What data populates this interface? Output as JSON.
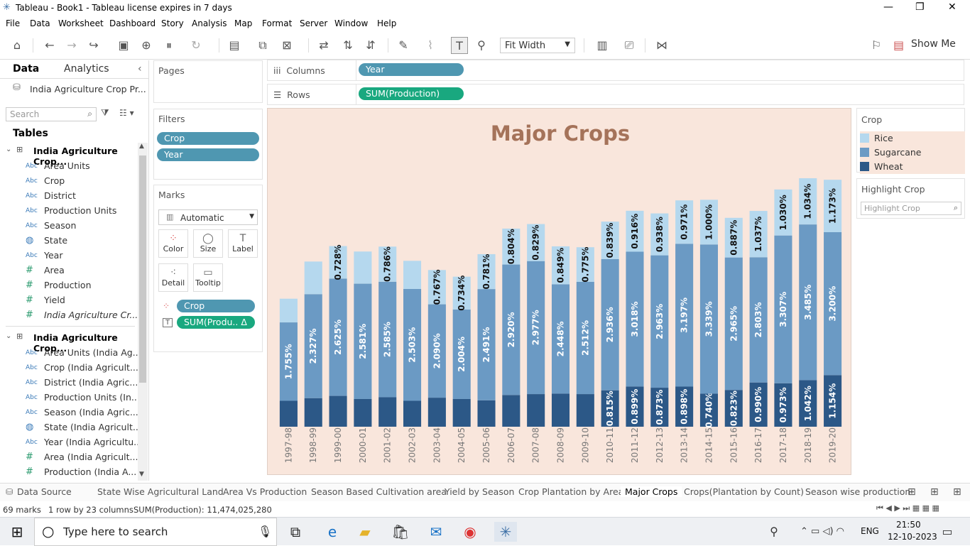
{
  "window": {
    "title": "Tableau - Book1 - Tableau license expires in 7 days"
  },
  "menu": [
    "File",
    "Data",
    "Worksheet",
    "Dashboard",
    "Story",
    "Analysis",
    "Map",
    "Format",
    "Server",
    "Window",
    "Help"
  ],
  "toolbar": {
    "fit": "Fit Width",
    "show_me": "Show Me"
  },
  "left_pane": {
    "tabs": [
      "Data",
      "Analytics"
    ],
    "datasource": "India Agriculture Crop Pr...",
    "search_placeholder": "Search",
    "tables_label": "Tables",
    "table1": {
      "name": "India Agriculture Crop...",
      "fields": [
        {
          "type": "Abc",
          "name": "Area Units"
        },
        {
          "type": "Abc",
          "name": "Crop"
        },
        {
          "type": "Abc",
          "name": "District"
        },
        {
          "type": "Abc",
          "name": "Production Units"
        },
        {
          "type": "Abc",
          "name": "Season"
        },
        {
          "type": "geo",
          "name": "State"
        },
        {
          "type": "Abc",
          "name": "Year"
        },
        {
          "type": "#",
          "name": "Area"
        },
        {
          "type": "#",
          "name": "Production"
        },
        {
          "type": "#",
          "name": "Yield"
        },
        {
          "type": "#",
          "name": "India Agriculture Cr..."
        }
      ]
    },
    "table2": {
      "name": "India Agriculture Crop...",
      "fields": [
        {
          "type": "Abc",
          "name": "Area Units (India Ag..."
        },
        {
          "type": "Abc",
          "name": "Crop (India Agricult..."
        },
        {
          "type": "Abc",
          "name": "District (India Agric..."
        },
        {
          "type": "Abc",
          "name": "Production Units (In..."
        },
        {
          "type": "Abc",
          "name": "Season (India Agric..."
        },
        {
          "type": "geo",
          "name": "State (India Agricult..."
        },
        {
          "type": "Abc",
          "name": "Year (India Agricultu..."
        },
        {
          "type": "#",
          "name": "Area (India Agricult..."
        },
        {
          "type": "#",
          "name": "Production (India A..."
        }
      ]
    }
  },
  "pages": {
    "title": "Pages"
  },
  "filters": {
    "title": "Filters",
    "items": [
      "Crop",
      "Year"
    ]
  },
  "marks": {
    "title": "Marks",
    "type": "Automatic",
    "buttons": [
      "Color",
      "Size",
      "Label",
      "Detail",
      "Tooltip"
    ],
    "pills": [
      "Crop",
      "SUM(Produ.. Δ"
    ]
  },
  "shelves": {
    "columns_label": "Columns",
    "columns_pill": "Year",
    "rows_label": "Rows",
    "rows_pill": "SUM(Production)"
  },
  "legend": {
    "title": "Crop",
    "items": [
      {
        "name": "Rice",
        "color": "#b5d8ee"
      },
      {
        "name": "Sugarcane",
        "color": "#6b9ac4"
      },
      {
        "name": "Wheat",
        "color": "#2c5887"
      }
    ]
  },
  "highlight": {
    "title": "Highlight Crop",
    "placeholder": "Highlight Crop"
  },
  "chart_data": {
    "type": "bar",
    "title": "Major Crops",
    "stacked": true,
    "categories": [
      "1997-98",
      "1998-99",
      "1999-00",
      "2000-01",
      "2001-02",
      "2002-03",
      "2003-04",
      "2004-05",
      "2005-06",
      "2006-07",
      "2007-08",
      "2008-09",
      "2009-10",
      "2010-11",
      "2011-12",
      "2012-13",
      "2013-14",
      "2014-15",
      "2015-16",
      "2016-17",
      "2017-18",
      "2018-19",
      "2019-20"
    ],
    "series": [
      {
        "name": "Wheat",
        "color": "#2c5887",
        "values": [
          0.58,
          0.64,
          0.69,
          0.62,
          0.66,
          0.58,
          0.65,
          0.62,
          0.59,
          0.71,
          0.73,
          0.74,
          0.73,
          0.815,
          0.899,
          0.873,
          0.898,
          0.74,
          0.823,
          0.99,
          0.973,
          1.042,
          1.154
        ],
        "labels": [
          "",
          "",
          "",
          "",
          "",
          "",
          "",
          "",
          "",
          "",
          "",
          "",
          "",
          "0.815%",
          "0.899%",
          "0.873%",
          "0.898%",
          "0.740%",
          "0.823%",
          "0.990%",
          "0.973%",
          "1.042%",
          "1.154%"
        ]
      },
      {
        "name": "Sugarcane",
        "color": "#6b9ac4",
        "values": [
          1.755,
          2.327,
          2.625,
          2.581,
          2.585,
          2.503,
          2.09,
          2.004,
          2.491,
          2.92,
          2.977,
          2.448,
          2.512,
          2.936,
          3.018,
          2.963,
          3.197,
          3.339,
          2.965,
          2.803,
          3.307,
          3.485,
          3.2
        ],
        "labels": [
          "1.755%",
          "2.327%",
          "2.625%",
          "2.581%",
          "2.585%",
          "2.503%",
          "2.090%",
          "2.004%",
          "2.491%",
          "2.920%",
          "2.977%",
          "2.448%",
          "2.512%",
          "2.936%",
          "3.018%",
          "2.963%",
          "3.197%",
          "3.339%",
          "2.965%",
          "2.803%",
          "3.307%",
          "3.485%",
          "3.200%"
        ]
      },
      {
        "name": "Rice",
        "color": "#b5d8ee",
        "values": [
          0.53,
          0.73,
          0.728,
          0.72,
          0.786,
          0.63,
          0.767,
          0.734,
          0.781,
          0.804,
          0.829,
          0.849,
          0.775,
          0.839,
          0.916,
          0.938,
          0.971,
          1.0,
          0.887,
          1.037,
          1.03,
          1.034,
          1.173
        ],
        "labels": [
          "",
          "",
          "0.728%",
          "",
          "0.786%",
          "",
          "0.767%",
          "0.734%",
          "0.781%",
          "0.804%",
          "0.829%",
          "0.849%",
          "0.775%",
          "0.839%",
          "0.916%",
          "0.938%",
          "0.971%",
          "1.000%",
          "0.887%",
          "1.037%",
          "1.030%",
          "1.034%",
          "1.173%"
        ]
      }
    ],
    "ylim": [
      0,
      5.8
    ]
  },
  "sheet_tabs": [
    "Data Source",
    "State Wise Agricultural Land",
    "Area Vs Production",
    "Season Based Cultivation area",
    "Yield by Season",
    "Crop Plantation by Area",
    "Major Crops",
    "Crops(Plantation by Count)",
    "Season wise production"
  ],
  "status": {
    "marks": "69 marks",
    "grid": "1 row by 23 columns",
    "sum": "SUM(Production): 11,474,025,280"
  },
  "taskbar": {
    "search": "Type here to search",
    "lang": "ENG",
    "time": "21:50",
    "date": "12-10-2023"
  }
}
